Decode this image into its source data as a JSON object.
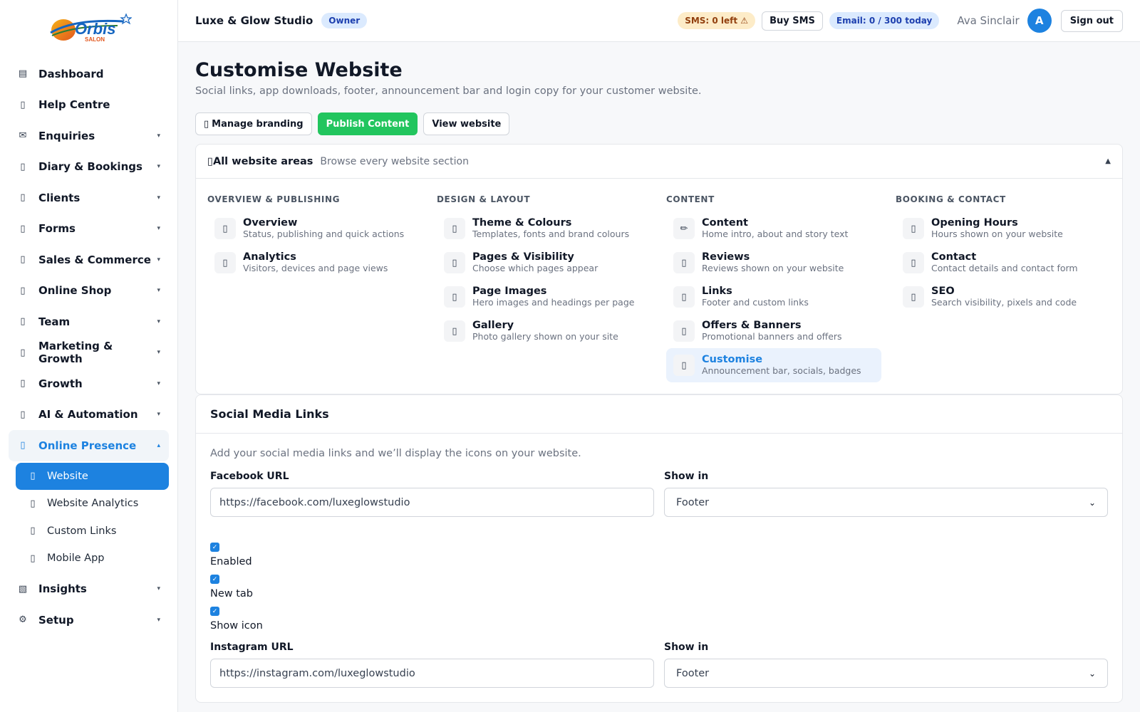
{
  "logo": {
    "text": "Orbis",
    "sub": "SALON"
  },
  "sidebar": {
    "items": [
      {
        "label": "Dashboard",
        "icon": "▤",
        "caret": ""
      },
      {
        "label": "Help Centre",
        "icon": "▯",
        "caret": ""
      },
      {
        "label": "Enquiries",
        "icon": "✉",
        "caret": "▾"
      },
      {
        "label": "Diary & Bookings",
        "icon": "▯",
        "caret": "▾"
      },
      {
        "label": "Clients",
        "icon": "▯",
        "caret": "▾"
      },
      {
        "label": "Forms",
        "icon": "▯",
        "caret": "▾"
      },
      {
        "label": "Sales & Commerce",
        "icon": "▯",
        "caret": "▾"
      },
      {
        "label": "Online Shop",
        "icon": "▯",
        "caret": "▾"
      },
      {
        "label": "Team",
        "icon": "▯",
        "caret": "▾"
      },
      {
        "label": "Marketing & Growth",
        "icon": "▯",
        "caret": "▾"
      },
      {
        "label": "Growth",
        "icon": "▯",
        "caret": "▾"
      },
      {
        "label": "AI & Automation",
        "icon": "▯",
        "caret": "▾"
      },
      {
        "label": "Online Presence",
        "icon": "▯",
        "caret": "▴"
      }
    ],
    "sub_items": [
      {
        "label": "Website",
        "icon": "▯"
      },
      {
        "label": "Website Analytics",
        "icon": "▯"
      },
      {
        "label": "Custom Links",
        "icon": "▯"
      },
      {
        "label": "Mobile App",
        "icon": "▯"
      }
    ],
    "bottom_items": [
      {
        "label": "Insights",
        "icon": "▧",
        "caret": "▾"
      },
      {
        "label": "Setup",
        "icon": "⚙",
        "caret": "▾"
      }
    ]
  },
  "header": {
    "studio": "Luxe & Glow Studio",
    "role": "Owner",
    "sms": "SMS: 0 left ⚠",
    "buy_sms": "Buy SMS",
    "email": "Email: 0 / 300 today",
    "user": "Ava Sinclair",
    "avatar": "A",
    "sign_out": "Sign out"
  },
  "page": {
    "title": "Customise Website",
    "subtitle": "Social links, app downloads, footer, announcement bar and login copy for your customer website.",
    "buttons": {
      "branding": "Manage branding",
      "branding_icon": "▯",
      "publish": "Publish Content",
      "view": "View website"
    }
  },
  "areas": {
    "title": "All website areas",
    "title_icon": "▯",
    "desc": "Browse every website section",
    "toggle": "▲",
    "columns": [
      {
        "title": "OVERVIEW & PUBLISHING",
        "items": [
          {
            "name": "Overview",
            "desc": "Status, publishing and quick actions",
            "icon": "▯"
          },
          {
            "name": "Analytics",
            "desc": "Visitors, devices and page views",
            "icon": "▯"
          }
        ]
      },
      {
        "title": "DESIGN & LAYOUT",
        "items": [
          {
            "name": "Theme & Colours",
            "desc": "Templates, fonts and brand colours",
            "icon": "▯"
          },
          {
            "name": "Pages & Visibility",
            "desc": "Choose which pages appear",
            "icon": "▯"
          },
          {
            "name": "Page Images",
            "desc": "Hero images and headings per page",
            "icon": "▯"
          },
          {
            "name": "Gallery",
            "desc": "Photo gallery shown on your site",
            "icon": "▯"
          }
        ]
      },
      {
        "title": "CONTENT",
        "items": [
          {
            "name": "Content",
            "desc": "Home intro, about and story text",
            "icon": "✏"
          },
          {
            "name": "Reviews",
            "desc": "Reviews shown on your website",
            "icon": "▯"
          },
          {
            "name": "Links",
            "desc": "Footer and custom links",
            "icon": "▯"
          },
          {
            "name": "Offers & Banners",
            "desc": "Promotional banners and offers",
            "icon": "▯"
          },
          {
            "name": "Customise",
            "desc": "Announcement bar, socials, badges",
            "icon": "▯"
          }
        ]
      },
      {
        "title": "BOOKING & CONTACT",
        "items": [
          {
            "name": "Opening Hours",
            "desc": "Hours shown on your website",
            "icon": "▯"
          },
          {
            "name": "Contact",
            "desc": "Contact details and contact form",
            "icon": "▯"
          },
          {
            "name": "SEO",
            "desc": "Search visibility, pixels and code",
            "icon": "▯"
          }
        ]
      }
    ]
  },
  "social": {
    "title": "Social Media Links",
    "hint": "Add your social media links and we’ll display the icons on your website.",
    "show_in_label": "Show in",
    "facebook": {
      "label": "Facebook URL",
      "value": "https://facebook.com/luxeglowstudio",
      "show_in": "Footer"
    },
    "instagram": {
      "label": "Instagram URL",
      "value": "https://instagram.com/luxeglowstudio",
      "show_in": "Footer"
    },
    "checks": [
      {
        "label": "Enabled",
        "checked": true
      },
      {
        "label": "New tab",
        "checked": true
      },
      {
        "label": "Show icon",
        "checked": true
      }
    ]
  },
  "colors": {
    "accent": "#1d82e0",
    "publish": "#22c55e"
  }
}
